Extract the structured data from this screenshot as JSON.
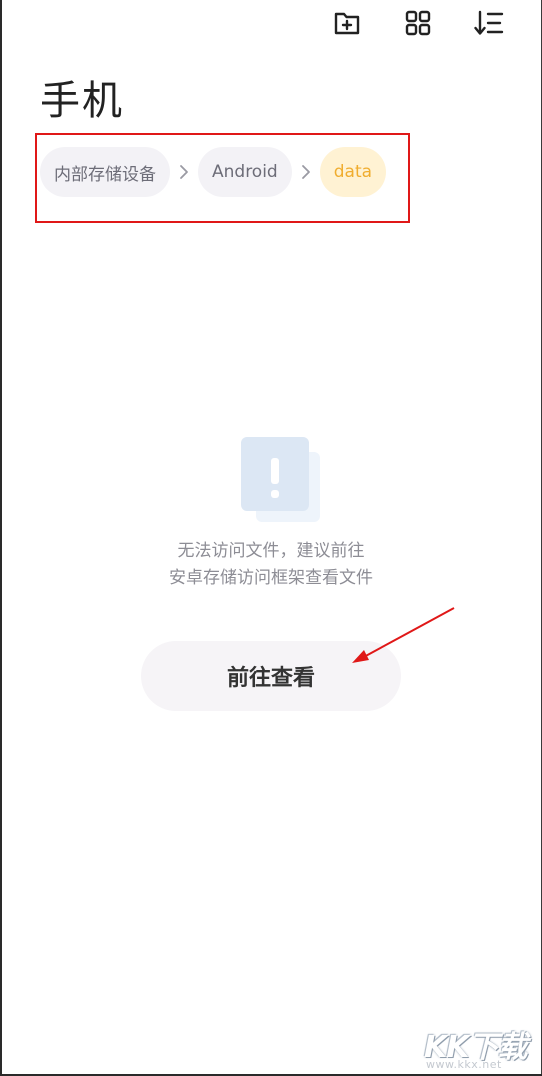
{
  "header": {
    "title": "手机",
    "actions": [
      {
        "name": "new-folder-icon"
      },
      {
        "name": "grid-view-icon"
      },
      {
        "name": "sort-icon"
      }
    ]
  },
  "breadcrumb": {
    "items": [
      {
        "label": "内部存储设备",
        "active": false
      },
      {
        "label": "Android",
        "active": false
      },
      {
        "label": "data",
        "active": true
      }
    ]
  },
  "empty_state": {
    "icon": "warning-document-icon",
    "message_line1": "无法访问文件，建议前往",
    "message_line2": "安卓存储访问框架查看文件",
    "button_label": "前往查看"
  },
  "watermark": {
    "logo": "KK下载",
    "url": "www.kkx.net"
  },
  "colors": {
    "accent": "#f0ad2f",
    "accent_bg": "#fff2d3",
    "chip_bg": "#f3f2f6",
    "annotation_red": "#e01818"
  }
}
